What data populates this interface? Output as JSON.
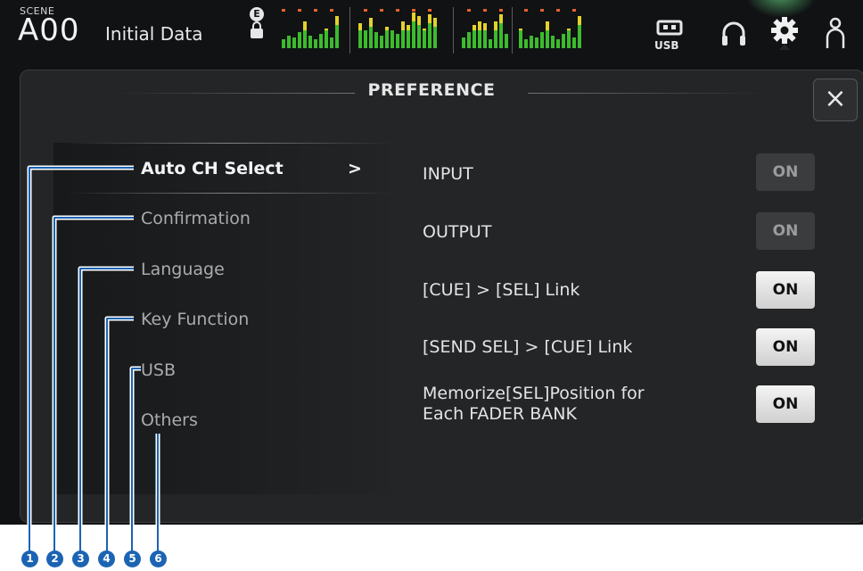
{
  "header": {
    "scene_label": "SCENE",
    "scene_number": "A00",
    "scene_title": "Initial Data",
    "badge_e": "E",
    "usb_label": "USB"
  },
  "panel": {
    "title": "PREFERENCE",
    "close_label": "×"
  },
  "sidebar": {
    "items": [
      {
        "label": "Auto CH Select",
        "active": true
      },
      {
        "label": "Confirmation",
        "active": false
      },
      {
        "label": "Language",
        "active": false
      },
      {
        "label": "Key Function",
        "active": false
      },
      {
        "label": "USB",
        "active": false
      },
      {
        "label": "Others",
        "active": false
      }
    ],
    "active_indicator": ">"
  },
  "options": [
    {
      "label": "INPUT",
      "state": "ON",
      "enabled": false
    },
    {
      "label": "OUTPUT",
      "state": "ON",
      "enabled": false
    },
    {
      "label": "[CUE] > [SEL] Link",
      "state": "ON",
      "enabled": true
    },
    {
      "label": "[SEND SEL] > [CUE] Link",
      "state": "ON",
      "enabled": true
    },
    {
      "label_line1": "Memorize[SEL]Position for",
      "label_line2": "Each FADER BANK",
      "state": "ON",
      "enabled": true
    }
  ],
  "callouts": [
    "1",
    "2",
    "3",
    "4",
    "5",
    "6"
  ],
  "colors": {
    "meter_green": "#3dbb2e",
    "meter_yellow": "#e3d22b",
    "meter_red": "#e8602b",
    "callout_blue": "#1b64b3"
  }
}
